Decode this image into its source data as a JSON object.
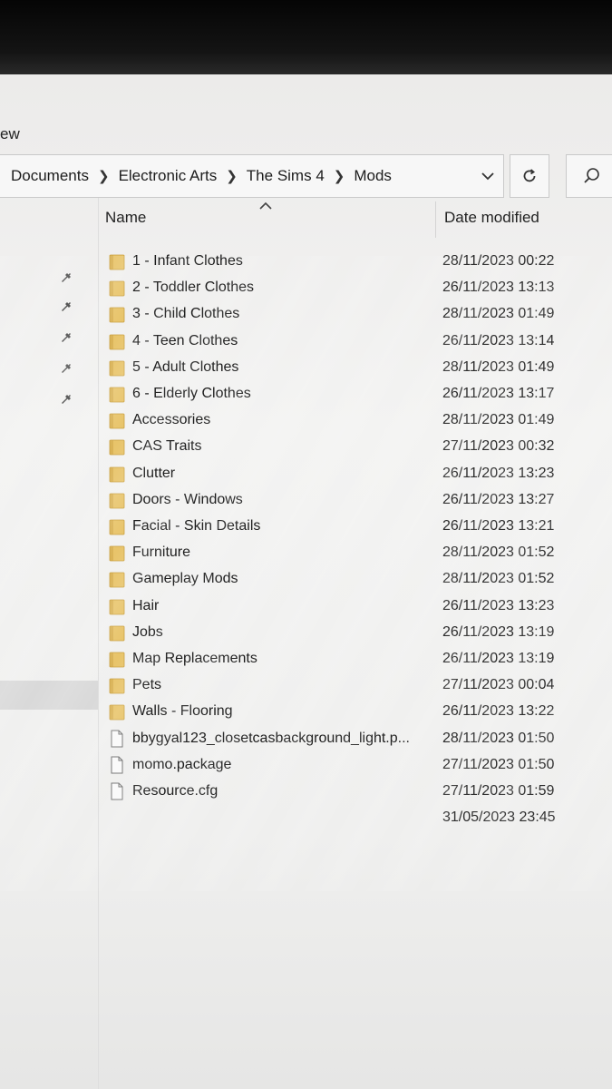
{
  "menu": {
    "fragment": "ew"
  },
  "breadcrumb": [
    "Documents",
    "Electronic Arts",
    "The Sims 4",
    "Mods"
  ],
  "columns": {
    "name": "Name",
    "date": "Date modified"
  },
  "files": [
    {
      "name": "1 - Infant Clothes",
      "date": "28/11/2023 00:22",
      "type": "folder"
    },
    {
      "name": "2 - Toddler Clothes",
      "date": "26/11/2023 13:13",
      "type": "folder"
    },
    {
      "name": "3 - Child Clothes",
      "date": "28/11/2023 01:49",
      "type": "folder"
    },
    {
      "name": "4 - Teen Clothes",
      "date": "26/11/2023 13:14",
      "type": "folder"
    },
    {
      "name": "5 - Adult Clothes",
      "date": "28/11/2023 01:49",
      "type": "folder"
    },
    {
      "name": "6 - Elderly Clothes",
      "date": "26/11/2023 13:17",
      "type": "folder"
    },
    {
      "name": "Accessories",
      "date": "28/11/2023 01:49",
      "type": "folder"
    },
    {
      "name": "CAS Traits",
      "date": "27/11/2023 00:32",
      "type": "folder"
    },
    {
      "name": "Clutter",
      "date": "26/11/2023 13:23",
      "type": "folder"
    },
    {
      "name": "Doors - Windows",
      "date": "26/11/2023 13:27",
      "type": "folder"
    },
    {
      "name": "Facial - Skin Details",
      "date": "26/11/2023 13:21",
      "type": "folder"
    },
    {
      "name": "Furniture",
      "date": "28/11/2023 01:52",
      "type": "folder"
    },
    {
      "name": "Gameplay Mods",
      "date": "28/11/2023 01:52",
      "type": "folder"
    },
    {
      "name": "Hair",
      "date": "26/11/2023 13:23",
      "type": "folder"
    },
    {
      "name": "Jobs",
      "date": "26/11/2023 13:19",
      "type": "folder"
    },
    {
      "name": "Map Replacements",
      "date": "26/11/2023 13:19",
      "type": "folder"
    },
    {
      "name": "Pets",
      "date": "27/11/2023 00:04",
      "type": "folder"
    },
    {
      "name": "Walls - Flooring",
      "date": "26/11/2023 13:22",
      "type": "folder"
    },
    {
      "name": "bbygyal123_closetcasbackground_light.p...",
      "date": "28/11/2023 01:50",
      "type": "file"
    },
    {
      "name": "momo.package",
      "date": "27/11/2023 01:50",
      "type": "file"
    },
    {
      "name": "Resource.cfg",
      "date": "27/11/2023 01:59",
      "type": "file"
    },
    {
      "name": "",
      "date": "31/05/2023 23:45",
      "type": "none"
    }
  ],
  "icons": {
    "folder": "folder-icon",
    "file": "file-icon",
    "pin": "pin-icon",
    "refresh": "refresh-icon",
    "search": "search-icon",
    "dropdown": "chevron-down-icon",
    "sort": "sort-ascending-icon"
  },
  "colors": {
    "folder": "#e8c46a",
    "folder_edge": "#c9a040"
  }
}
